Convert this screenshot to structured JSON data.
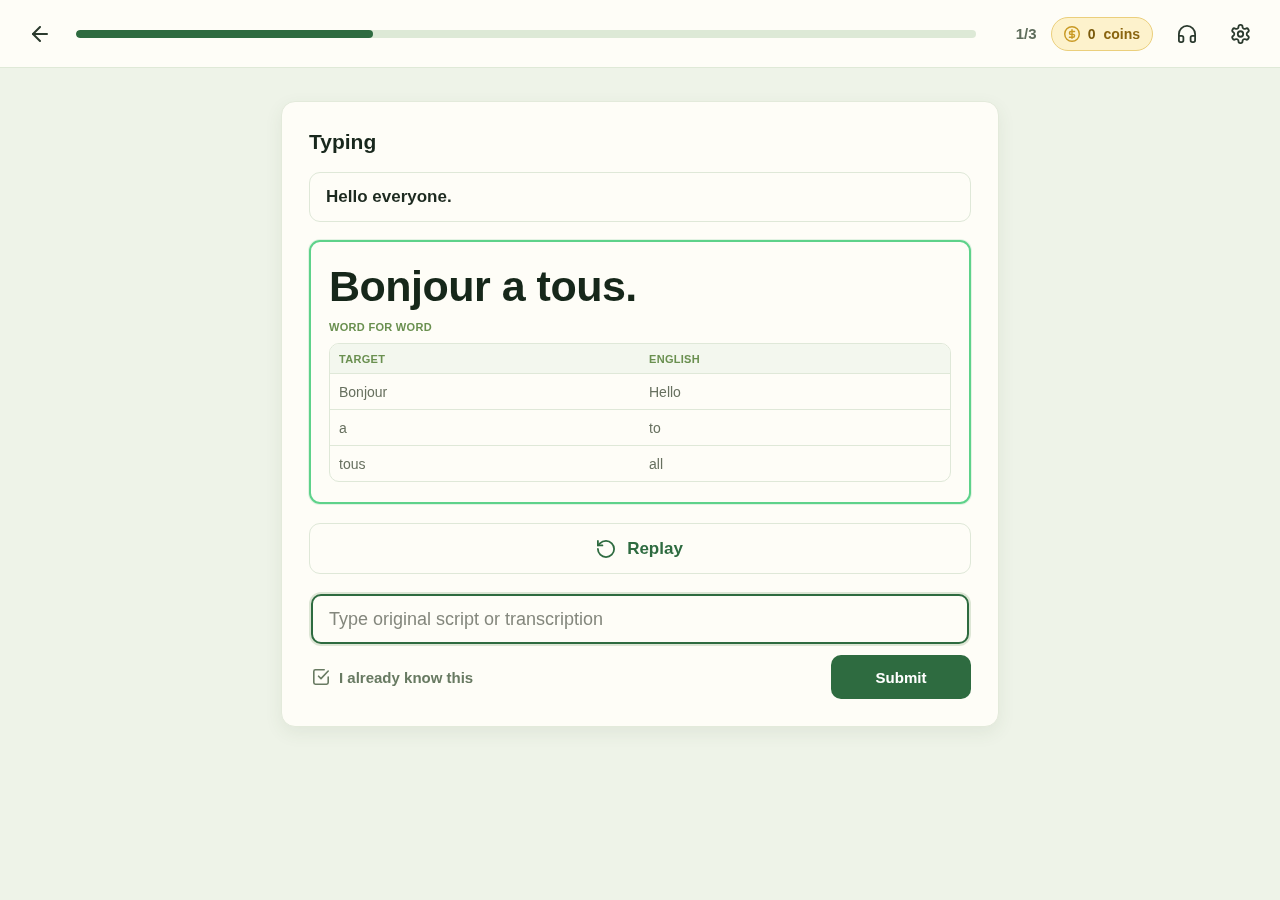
{
  "top_bar": {
    "progress": {
      "level": 0.33
    },
    "step_counter": "1/3",
    "coins": {
      "amount": "0",
      "label": "coins"
    }
  },
  "card": {
    "title": "Typing",
    "prompt": "Hello everyone.",
    "answer": {
      "text": "Bonjour a tous.",
      "word_for_word": {
        "heading": "WORD FOR WORD",
        "columns": [
          "TARGET",
          "ENGLISH"
        ],
        "rows": [
          [
            "Bonjour",
            "Hello"
          ],
          [
            "a",
            "to"
          ],
          [
            "tous",
            "all"
          ]
        ]
      }
    },
    "replay_button": "Replay",
    "answer_field": {
      "placeholder": "Type original script or transcription"
    },
    "know_button": "I already know this",
    "submit_button": "Submit"
  }
}
